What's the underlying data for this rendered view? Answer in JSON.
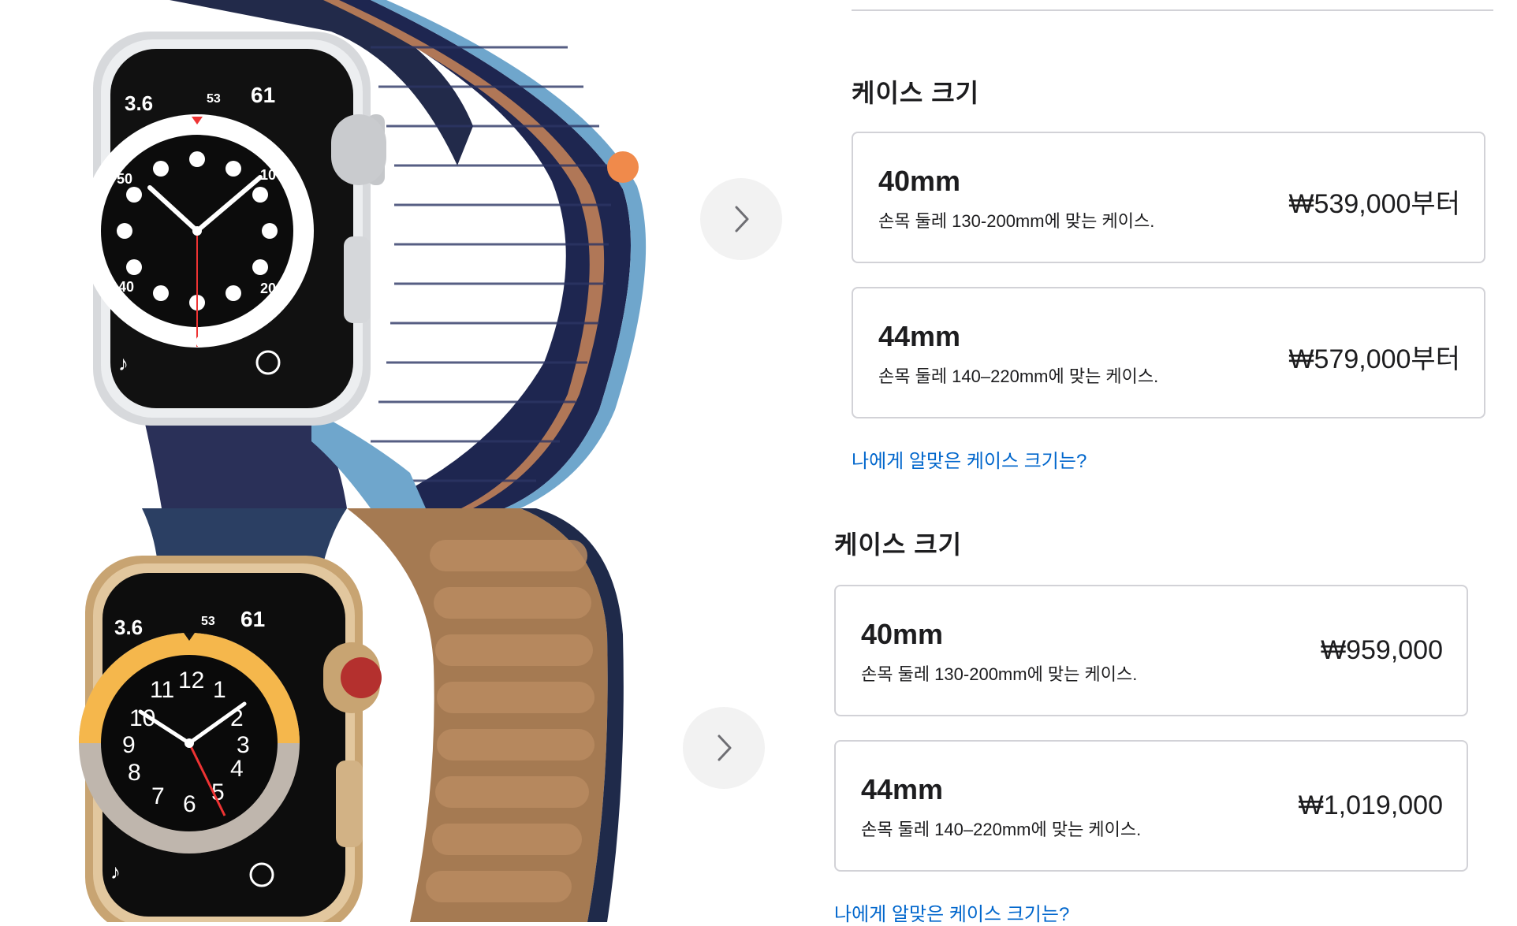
{
  "colors": {
    "accent_link": "#0066cc",
    "border": "#d2d2d7",
    "nav_bg": "#f2f2f2"
  },
  "section1": {
    "image_desc": "silver-aluminum-watch-navy-sport-loop",
    "heading": "케이스 크기",
    "options": [
      {
        "size": "40mm",
        "desc": "손목 둘레 130-200mm에 맞는 케이스.",
        "price": "₩539,000부터"
      },
      {
        "size": "44mm",
        "desc": "손목 둘레 140–220mm에 맞는 케이스.",
        "price": "₩579,000부터"
      }
    ],
    "help_link": "나에게 알맞은 케이스 크기는?"
  },
  "section2": {
    "image_desc": "gold-steel-watch-leather-link",
    "heading": "케이스 크기",
    "options": [
      {
        "size": "40mm",
        "desc": "손목 둘레 130-200mm에 맞는 케이스.",
        "price": "₩959,000"
      },
      {
        "size": "44mm",
        "desc": "손목 둘레 140–220mm에 맞는 케이스.",
        "price": "₩1,019,000"
      }
    ],
    "help_link": "나에게 알맞은 케이스 크기는?"
  }
}
